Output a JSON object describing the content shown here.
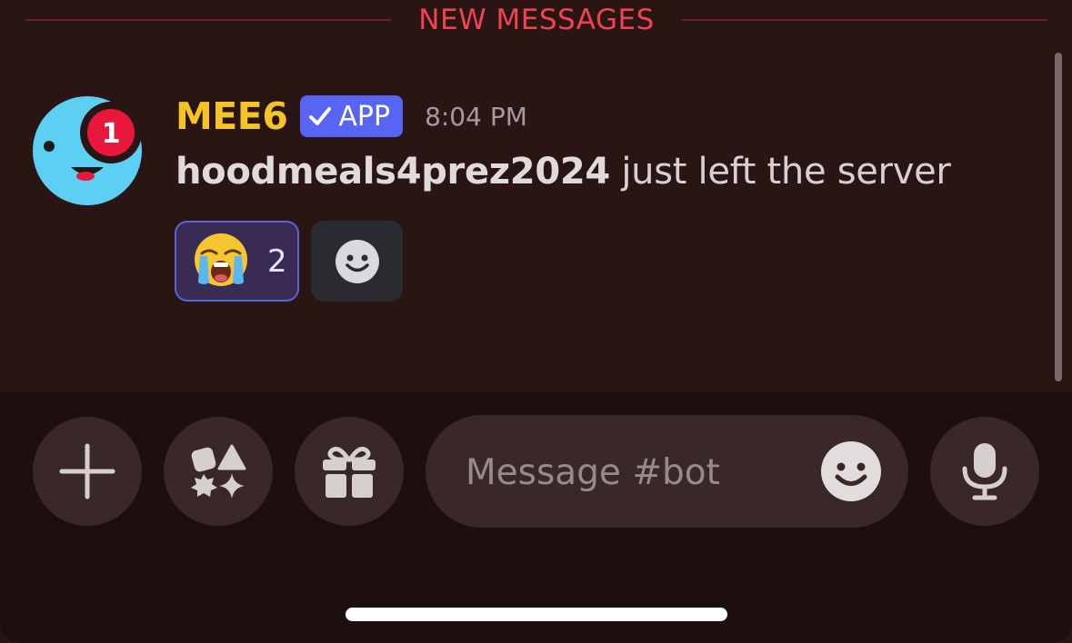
{
  "divider": {
    "label": "NEW MESSAGES"
  },
  "message": {
    "username": "MEE6",
    "badge_label": "APP",
    "timestamp": "8:04 PM",
    "avatar_notification_count": "1",
    "mention": "hoodmeals4prez2024",
    "text": " just left the server"
  },
  "reactions": [
    {
      "emoji": "loudly-crying-face",
      "count": "2"
    }
  ],
  "composer": {
    "placeholder": "Message #bot",
    "buttons": [
      "plus-icon",
      "apps-icon",
      "gift-icon",
      "emoji-icon",
      "microphone-icon"
    ]
  },
  "colors": {
    "background": "#2a1515",
    "divider": "#f04250",
    "username": "#f6c324",
    "badge": "#5865f2",
    "reaction_border": "#5b63d8"
  }
}
